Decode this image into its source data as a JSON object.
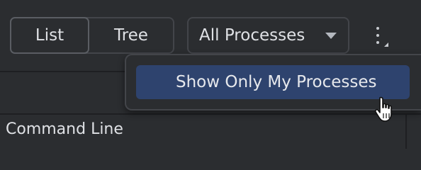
{
  "toolbar": {
    "view_toggle": {
      "list_label": "List",
      "tree_label": "Tree",
      "selected": "List"
    },
    "process_filter": {
      "value": "All Processes",
      "icon": "chevron-down-icon"
    },
    "more_icon": "more-vertical-icon"
  },
  "popup": {
    "items": [
      {
        "label": "Show Only My Processes",
        "highlighted": true
      }
    ]
  },
  "table": {
    "columns": [
      {
        "label": "Command Line"
      }
    ]
  },
  "cursor": {
    "icon": "hand-pointer-icon"
  },
  "colors": {
    "background": "#2b2d30",
    "border": "#43454a",
    "highlight": "#2e436e",
    "text": "#dfe1e5"
  }
}
